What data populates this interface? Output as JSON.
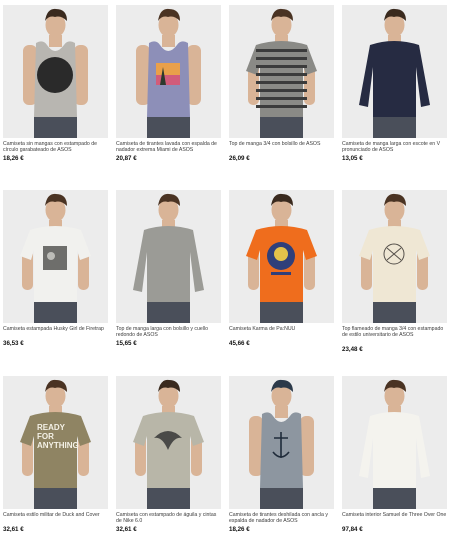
{
  "products": [
    {
      "title": "Camiseta sin mangas con estampado de círculo garabateado de ASOS",
      "price": "18,26 €",
      "shirt_color": "#b8b6b1",
      "pattern": "circle",
      "icon": "tank-top-icon"
    },
    {
      "title": "Camiseta de tirantes lavada con espalda de nadador extrema Miami de ASOS",
      "price": "20,87 €",
      "shirt_color": "#8d8fb8",
      "pattern": "sunset",
      "icon": "tank-top-icon"
    },
    {
      "title": "Top de manga 3/4 con bolsillo de ASOS",
      "price": "26,09 €",
      "shirt_color": "#8a8a86",
      "pattern": "stripes",
      "icon": "tshirt-icon"
    },
    {
      "title": "Camiseta de manga larga con escote en V pronunciado de ASOS",
      "price": "13,05 €",
      "shirt_color": "#262b42",
      "pattern": "plain",
      "icon": "long-sleeve-icon"
    },
    {
      "title": "Camiseta estampada Husky Girl de Firetrap",
      "price": "36,53 €",
      "shirt_color": "#f1f1ee",
      "pattern": "photo",
      "icon": "tshirt-icon"
    },
    {
      "title": "Top de manga larga con bolsillo y cuello redondo de ASOS",
      "price": "15,65 €",
      "shirt_color": "#9b9b96",
      "pattern": "plain",
      "icon": "long-sleeve-icon"
    },
    {
      "title": "Camiseta Karma de Pa:NUU",
      "price": "45,66 €",
      "shirt_color": "#ef6d1d",
      "pattern": "karma",
      "icon": "tshirt-icon"
    },
    {
      "title": "Top flameado de manga 3/4 con estampado de estilo universitario de ASOS",
      "price": "23,48 €",
      "shirt_color": "#efe7d4",
      "pattern": "emblem",
      "icon": "tshirt-icon"
    },
    {
      "title": "Camiseta estilo militar de Duck and Cover",
      "price": "32,61 €",
      "shirt_color": "#8f8463",
      "pattern": "ready",
      "icon": "tshirt-icon"
    },
    {
      "title": "Camiseta con estampado de águila y cintas de Nike 6.0",
      "price": "32,61 €",
      "shirt_color": "#b8b6a8",
      "pattern": "eagle",
      "icon": "tshirt-icon"
    },
    {
      "title": "Camiseta de tirantes deshilada con ancla y espalda de nadador de ASOS",
      "price": "18,26 €",
      "shirt_color": "#8d96a0",
      "pattern": "anchor",
      "icon": "tank-top-icon"
    },
    {
      "title": "Camiseta interior Samuel de Three Over One",
      "price": "97,84 €",
      "shirt_color": "#f4f3ee",
      "pattern": "plain",
      "icon": "long-sleeve-icon"
    }
  ],
  "ready_print": [
    "READY",
    "FOR",
    "ANYTHING"
  ]
}
